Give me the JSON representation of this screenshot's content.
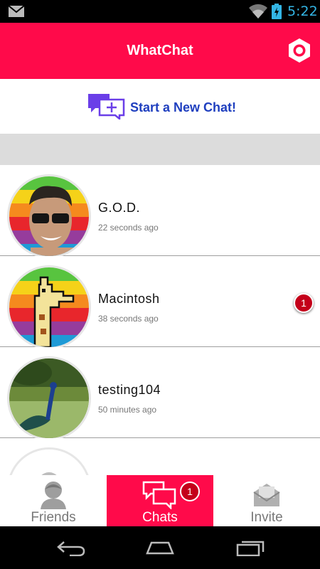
{
  "status_bar": {
    "time": "5:22",
    "icons": [
      "mail-icon",
      "wifi-icon",
      "battery-icon"
    ]
  },
  "app_bar": {
    "title": "WhatChat",
    "settings_icon": "gear-icon"
  },
  "new_chat": {
    "label": "Start a New Chat!",
    "icon": "new-chat-icon"
  },
  "chats": [
    {
      "name": "G.O.D.",
      "time": "22 seconds ago",
      "unread": ""
    },
    {
      "name": "Macintosh",
      "time": "38 seconds ago",
      "unread": "1"
    },
    {
      "name": "testing104",
      "time": "50 minutes ago",
      "unread": ""
    },
    {
      "name": "",
      "time": "",
      "unread": ""
    }
  ],
  "tabs": [
    {
      "label": "Friends",
      "icon": "friends-icon",
      "active": false
    },
    {
      "label": "Chats",
      "icon": "chats-icon",
      "active": true,
      "badge": "1"
    },
    {
      "label": "Invite",
      "icon": "invite-icon",
      "active": false
    }
  ],
  "colors": {
    "accent": "#ff0a4a",
    "link": "#1f3fbf",
    "badge": "#c4001a"
  }
}
